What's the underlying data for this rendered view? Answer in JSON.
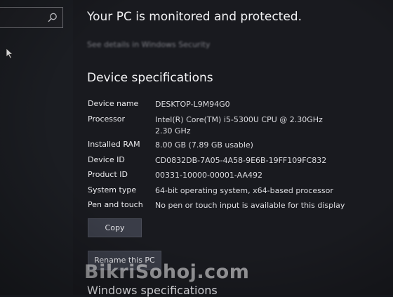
{
  "status": {
    "headline": "Your PC is monitored and protected.",
    "link": "See details in Windows Security"
  },
  "device_specs": {
    "title": "Device specifications",
    "rows": [
      {
        "label": "Device name",
        "value": "DESKTOP-L9M94G0"
      },
      {
        "label": "Processor",
        "value": "Intel(R) Core(TM) i5-5300U CPU @ 2.30GHz   2.30 GHz"
      },
      {
        "label": "Installed RAM",
        "value": "8.00 GB (7.89 GB usable)"
      },
      {
        "label": "Device ID",
        "value": "CD0832DB-7A05-4A58-9E6B-19FF109FC832"
      },
      {
        "label": "Product ID",
        "value": "00331-10000-00001-AA492"
      },
      {
        "label": "System type",
        "value": "64-bit operating system, x64-based processor"
      },
      {
        "label": "Pen and touch",
        "value": "No pen or touch input is available for this display"
      }
    ],
    "copy_label": "Copy",
    "rename_label": "Rename this PC"
  },
  "windows_specs": {
    "title": "Windows specifications"
  },
  "watermark": "BikriSohoj.com",
  "icons": {
    "search": "search-icon",
    "cursor": "mouse-pointer-icon"
  }
}
